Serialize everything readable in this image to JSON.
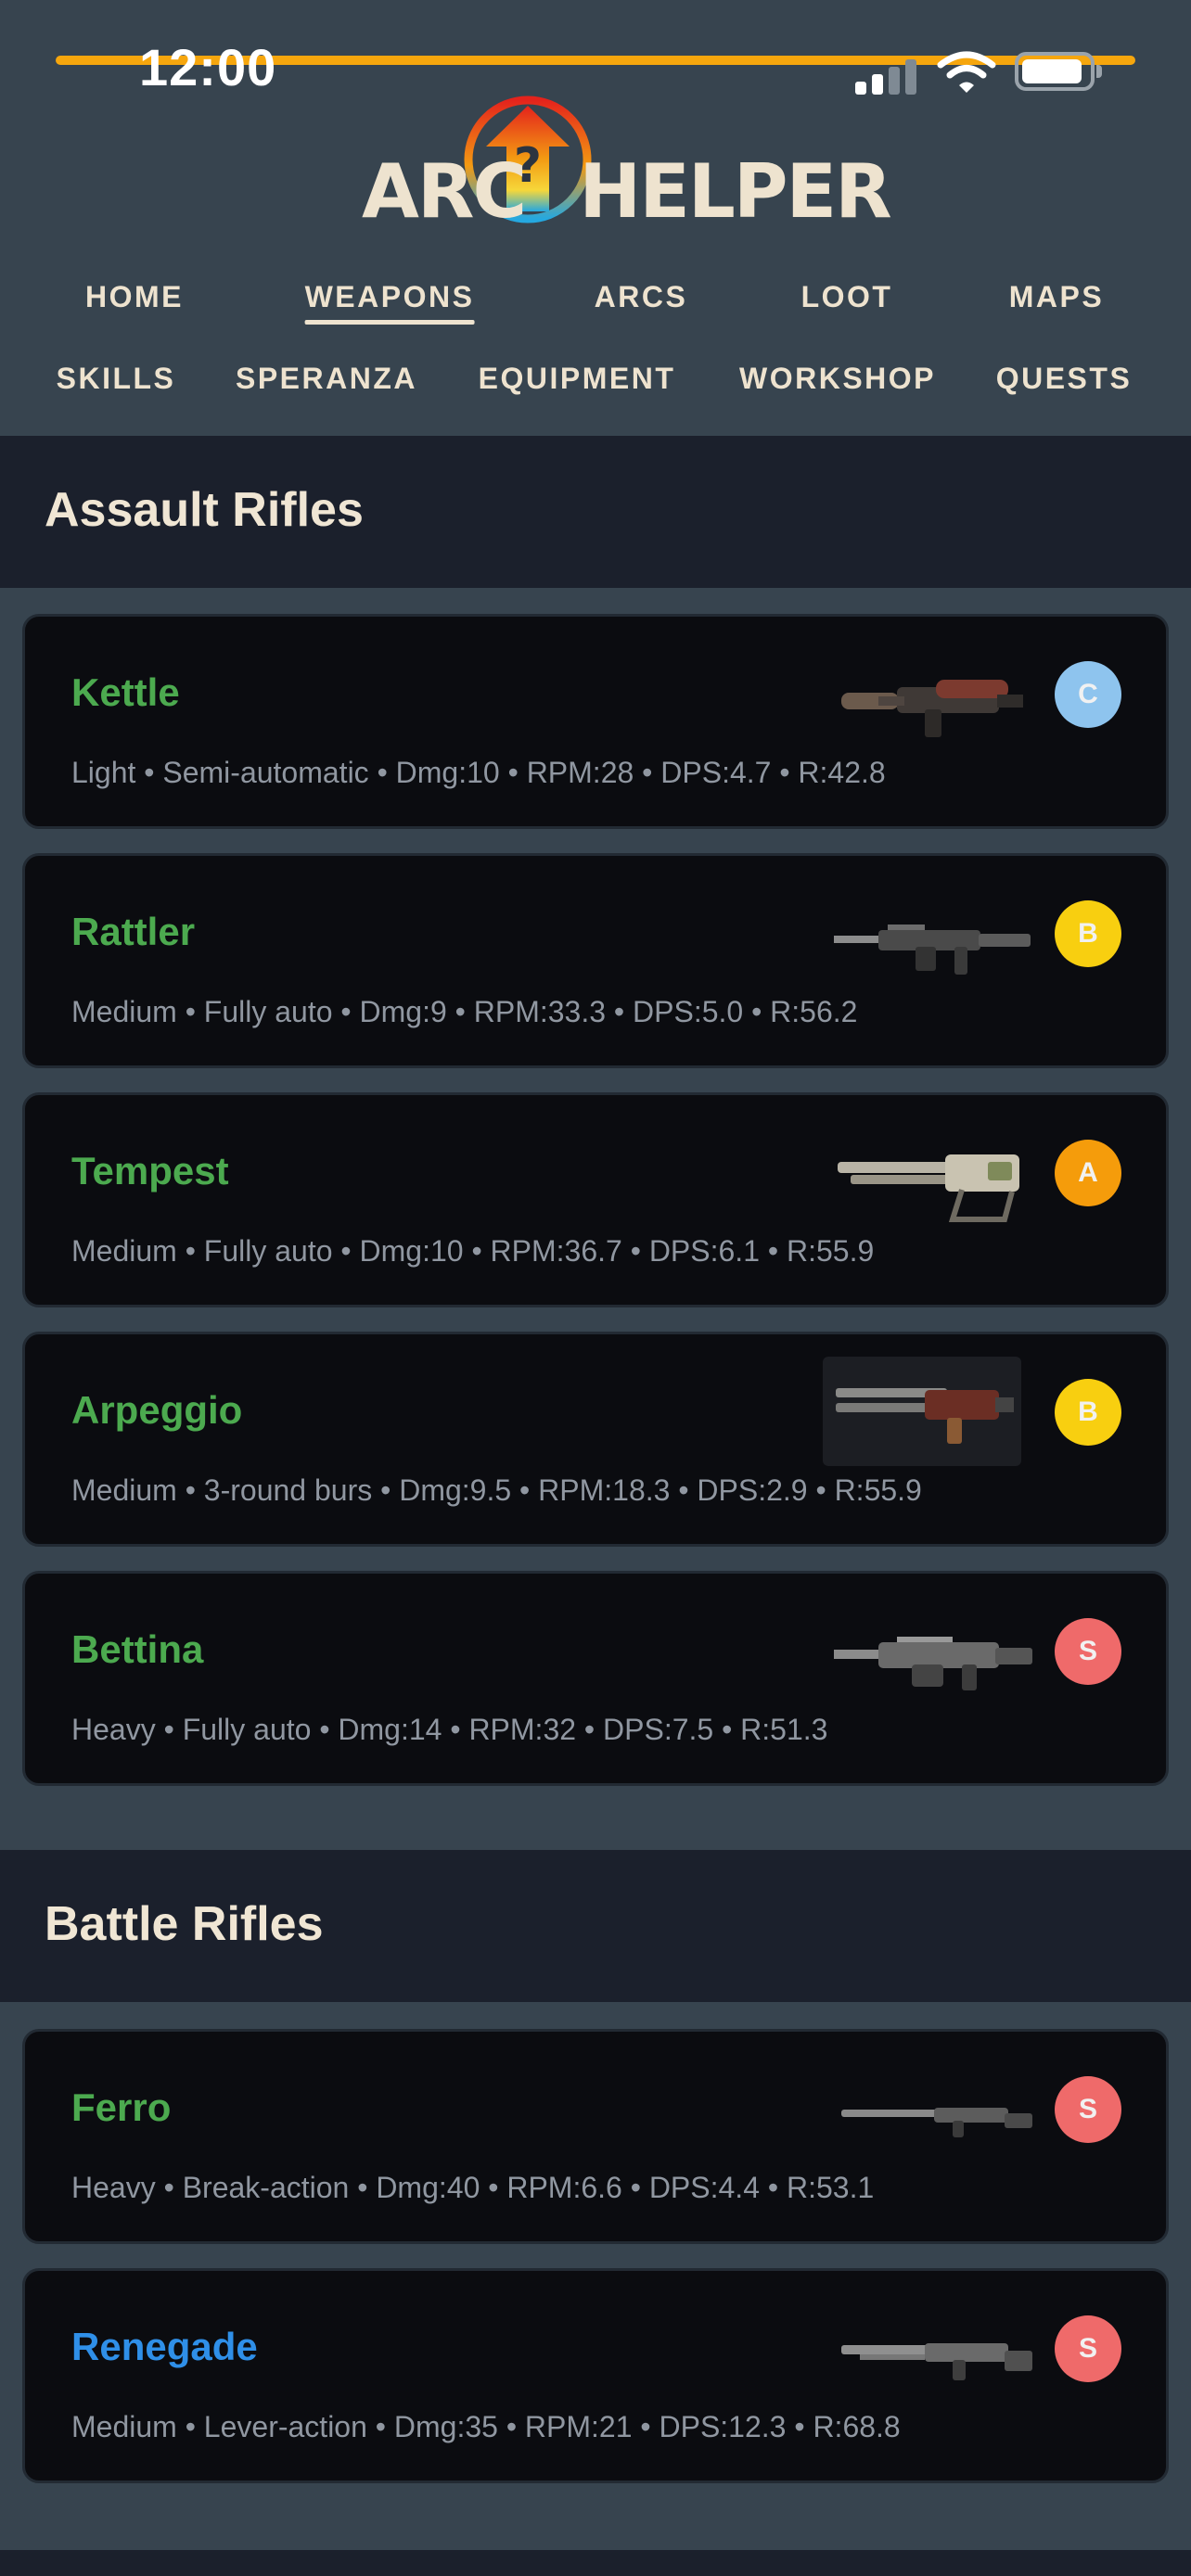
{
  "status_bar": {
    "time": "12:00",
    "icons": [
      "signal-icon",
      "wifi-icon",
      "battery-icon"
    ],
    "accent_line_color": "#f6a60d"
  },
  "logo": {
    "part1": "ARC",
    "part2": "HELPER",
    "mark_symbol": "?"
  },
  "nav": {
    "row1": [
      "HOME",
      "WEAPONS",
      "ARCS",
      "LOOT",
      "MAPS"
    ],
    "row2": [
      "SKILLS",
      "SPERANZA",
      "EQUIPMENT",
      "WORKSHOP",
      "QUESTS"
    ],
    "active": "WEAPONS"
  },
  "colors": {
    "page_bg": "#37444f",
    "section_bg": "#1b202c",
    "card_bg": "#0b0c10",
    "name_green": "#4caa4f",
    "name_blue": "#2f8fe8",
    "stats_text": "#9097a1",
    "tier_C": "#8ec4ee",
    "tier_B": "#f8cf10",
    "tier_A": "#f59c0b",
    "tier_S": "#ef6a6a"
  },
  "sections": [
    {
      "title": "Assault Rifles",
      "weapons": [
        {
          "name": "Kettle",
          "stats": "Light • Semi-automatic • Dmg:10 • RPM:28 • DPS:4.7 • R:42.8",
          "tier": "C",
          "image": "kettle-rifle-image"
        },
        {
          "name": "Rattler",
          "stats": "Medium • Fully auto • Dmg:9 • RPM:33.3 • DPS:5.0 • R:56.2",
          "tier": "B",
          "image": "rattler-rifle-image"
        },
        {
          "name": "Tempest",
          "stats": "Medium • Fully auto • Dmg:10 • RPM:36.7 • DPS:6.1 • R:55.9",
          "tier": "A",
          "image": "tempest-rifle-image"
        },
        {
          "name": "Arpeggio",
          "stats": "Medium • 3-round burs • Dmg:9.5 • RPM:18.3 • DPS:2.9 • R:55.9",
          "tier": "B",
          "image": "arpeggio-rifle-image"
        },
        {
          "name": "Bettina",
          "stats": "Heavy • Fully auto • Dmg:14 • RPM:32 • DPS:7.5 • R:51.3",
          "tier": "S",
          "image": "bettina-rifle-image"
        }
      ]
    },
    {
      "title": "Battle Rifles",
      "weapons": [
        {
          "name": "Ferro",
          "stats": "Heavy • Break-action • Dmg:40 • RPM:6.6 • DPS:4.4 • R:53.1",
          "tier": "S",
          "image": "ferro-rifle-image"
        },
        {
          "name": "Renegade",
          "stats": "Medium • Lever-action • Dmg:35 • RPM:21 • DPS:12.3 • R:68.8",
          "tier": "S",
          "image": "renegade-rifle-image"
        }
      ]
    }
  ]
}
